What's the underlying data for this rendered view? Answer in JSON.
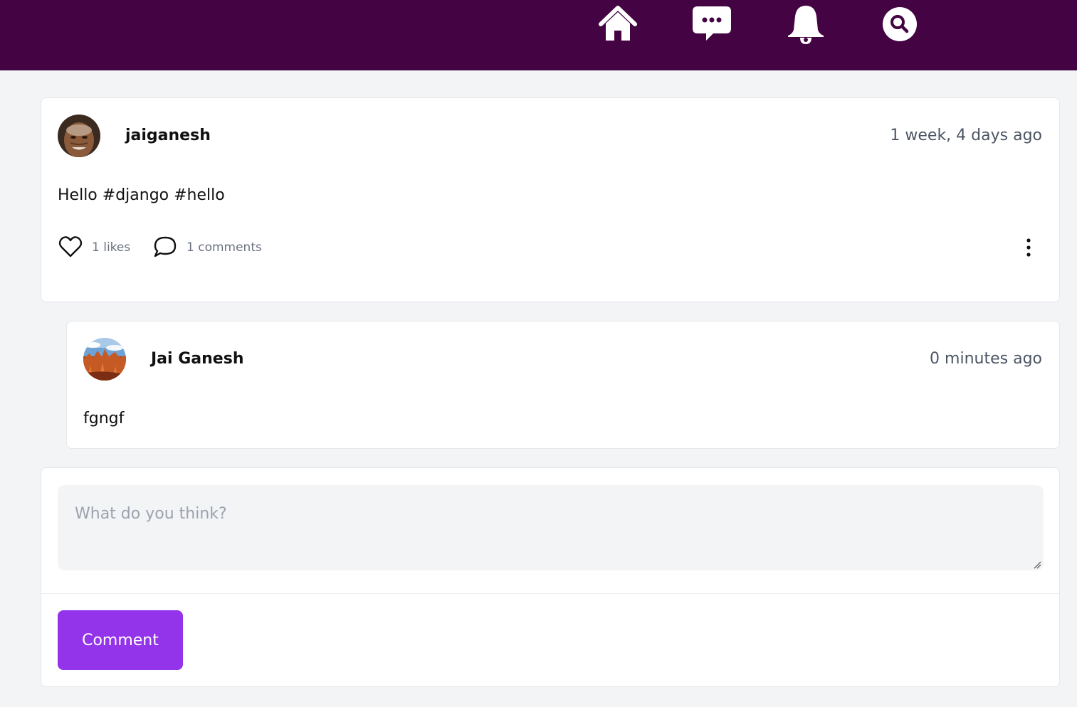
{
  "nav": {
    "icons": [
      "home-icon",
      "chat-icon",
      "bell-icon",
      "search-icon"
    ],
    "color": "#440443"
  },
  "post": {
    "author": "jaiganesh",
    "time": "1 week, 4 days ago",
    "text": "Hello #django #hello",
    "likes": "1 likes",
    "comments": "1 comments"
  },
  "comment": {
    "author": "Jai Ganesh",
    "time": "0 minutes ago",
    "text": "fgngf"
  },
  "form": {
    "placeholder": "What do you think?",
    "submit_label": "Comment"
  },
  "colors": {
    "accent": "#9333ea",
    "background": "#f3f4f6",
    "muted_text": "#6b7280"
  }
}
